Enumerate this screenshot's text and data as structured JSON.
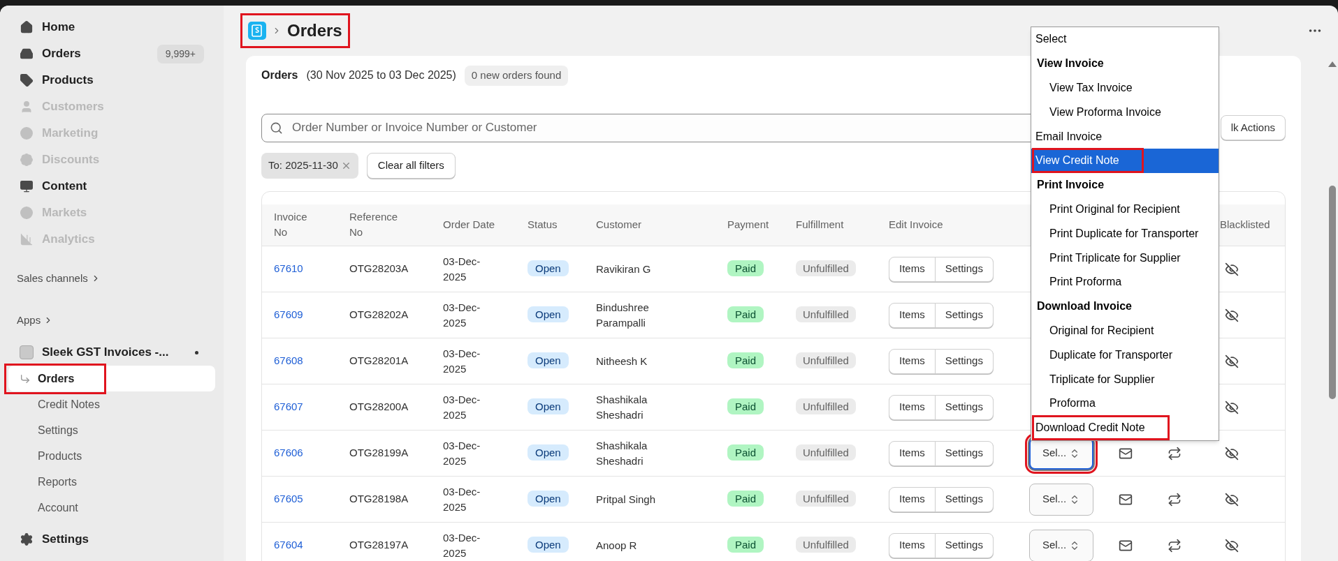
{
  "sidebar": {
    "items": [
      {
        "label": "Home",
        "disabled": false
      },
      {
        "label": "Orders",
        "disabled": false,
        "badge": "9,999+"
      },
      {
        "label": "Products",
        "disabled": false
      },
      {
        "label": "Customers",
        "disabled": true
      },
      {
        "label": "Marketing",
        "disabled": true
      },
      {
        "label": "Discounts",
        "disabled": true
      },
      {
        "label": "Content",
        "disabled": false
      },
      {
        "label": "Markets",
        "disabled": true
      },
      {
        "label": "Analytics",
        "disabled": true
      }
    ],
    "sections": [
      "Sales channels",
      "Apps"
    ],
    "app": {
      "name": "Sleek GST Invoices -...",
      "subitems": [
        {
          "label": "Orders",
          "selected": true,
          "highlighted": true
        },
        {
          "label": "Credit Notes",
          "selected": false,
          "highlighted": false
        },
        {
          "label": "Settings",
          "selected": false,
          "highlighted": false
        },
        {
          "label": "Products",
          "selected": false,
          "highlighted": false
        },
        {
          "label": "Reports",
          "selected": false,
          "highlighted": false
        },
        {
          "label": "Account",
          "selected": false,
          "highlighted": false
        }
      ]
    },
    "settings": "Settings"
  },
  "breadcrumb": {
    "title": "Orders",
    "highlighted": true
  },
  "card": {
    "title": "Orders",
    "date_range": "(30 Nov 2025 to 03 Dec 2025)",
    "new_orders": "0 new orders found",
    "search": {
      "placeholder": "Order Number or Invoice Number or Customer"
    },
    "bulk_actions": "lk Actions",
    "filter_chip": "To: 2025-11-30",
    "clear_filters": "Clear all filters"
  },
  "table": {
    "columns": [
      "Invoice No",
      "Reference No",
      "Order Date",
      "Status",
      "Customer",
      "Payment",
      "Fulfillment",
      "Edit Invoice",
      "Blacklisted"
    ],
    "rows": [
      {
        "invoice": "67610",
        "reference": "OTG28203A",
        "date": "03-Dec-2025",
        "status": "Open",
        "customer": "Ravikiran G",
        "payment": "Paid",
        "fulfillment": "Unfulfilled",
        "edit": [
          "Items",
          "Settings"
        ]
      },
      {
        "invoice": "67609",
        "reference": "OTG28202A",
        "date": "03-Dec-2025",
        "status": "Open",
        "customer": "Bindushree Parampalli",
        "payment": "Paid",
        "fulfillment": "Unfulfilled",
        "edit": [
          "Items",
          "Settings"
        ]
      },
      {
        "invoice": "67608",
        "reference": "OTG28201A",
        "date": "03-Dec-2025",
        "status": "Open",
        "customer": "Nitheesh K",
        "payment": "Paid",
        "fulfillment": "Unfulfilled",
        "edit": [
          "Items",
          "Settings"
        ]
      },
      {
        "invoice": "67607",
        "reference": "OTG28200A",
        "date": "03-Dec-2025",
        "status": "Open",
        "customer": "Shashikala Sheshadri",
        "payment": "Paid",
        "fulfillment": "Unfulfilled",
        "edit": [
          "Items",
          "Settings"
        ]
      },
      {
        "invoice": "67606",
        "reference": "OTG28199A",
        "date": "03-Dec-2025",
        "status": "Open",
        "customer": "Shashikala Sheshadri",
        "payment": "Paid",
        "fulfillment": "Unfulfilled",
        "edit": [
          "Items",
          "Settings"
        ],
        "select": {
          "value": "Sel...",
          "focused": true,
          "highlighted": true
        }
      },
      {
        "invoice": "67605",
        "reference": "OTG28198A",
        "date": "03-Dec-2025",
        "status": "Open",
        "customer": "Pritpal Singh",
        "payment": "Paid",
        "fulfillment": "Unfulfilled",
        "edit": [
          "Items",
          "Settings"
        ],
        "select": {
          "value": "Sel...",
          "focused": false,
          "highlighted": false
        }
      },
      {
        "invoice": "67604",
        "reference": "OTG28197A",
        "date": "03-Dec-2025",
        "status": "Open",
        "customer": "Anoop R",
        "payment": "Paid",
        "fulfillment": "Unfulfilled",
        "edit": [
          "Items",
          "Settings"
        ],
        "select": {
          "value": "Sel...",
          "focused": false,
          "highlighted": false
        }
      }
    ]
  },
  "dropdown": {
    "options": [
      {
        "label": "Select",
        "kind": "option",
        "selected": false,
        "highlighted": false
      },
      {
        "label": "View Invoice",
        "kind": "group",
        "selected": false,
        "highlighted": false
      },
      {
        "label": "View Tax Invoice",
        "kind": "suboption",
        "selected": false,
        "highlighted": false
      },
      {
        "label": "View Proforma Invoice",
        "kind": "suboption",
        "selected": false,
        "highlighted": false
      },
      {
        "label": "Email Invoice",
        "kind": "option",
        "selected": false,
        "highlighted": false
      },
      {
        "label": "View Credit Note",
        "kind": "option",
        "selected": true,
        "highlighted": true
      },
      {
        "label": "Print Invoice",
        "kind": "group",
        "selected": false,
        "highlighted": false
      },
      {
        "label": "Print Original for Recipient",
        "kind": "suboption",
        "selected": false,
        "highlighted": false
      },
      {
        "label": "Print Duplicate for Transporter",
        "kind": "suboption",
        "selected": false,
        "highlighted": false
      },
      {
        "label": "Print Triplicate for Supplier",
        "kind": "suboption",
        "selected": false,
        "highlighted": false
      },
      {
        "label": "Print Proforma",
        "kind": "suboption",
        "selected": false,
        "highlighted": false
      },
      {
        "label": "Download Invoice",
        "kind": "group",
        "selected": false,
        "highlighted": false
      },
      {
        "label": "Original for Recipient",
        "kind": "suboption",
        "selected": false,
        "highlighted": false
      },
      {
        "label": "Duplicate for Transporter",
        "kind": "suboption",
        "selected": false,
        "highlighted": false
      },
      {
        "label": "Triplicate for Supplier",
        "kind": "suboption",
        "selected": false,
        "highlighted": false
      },
      {
        "label": "Proforma",
        "kind": "suboption",
        "selected": false,
        "highlighted": false
      },
      {
        "label": "Download Credit Note",
        "kind": "option",
        "selected": false,
        "highlighted": true
      }
    ]
  }
}
